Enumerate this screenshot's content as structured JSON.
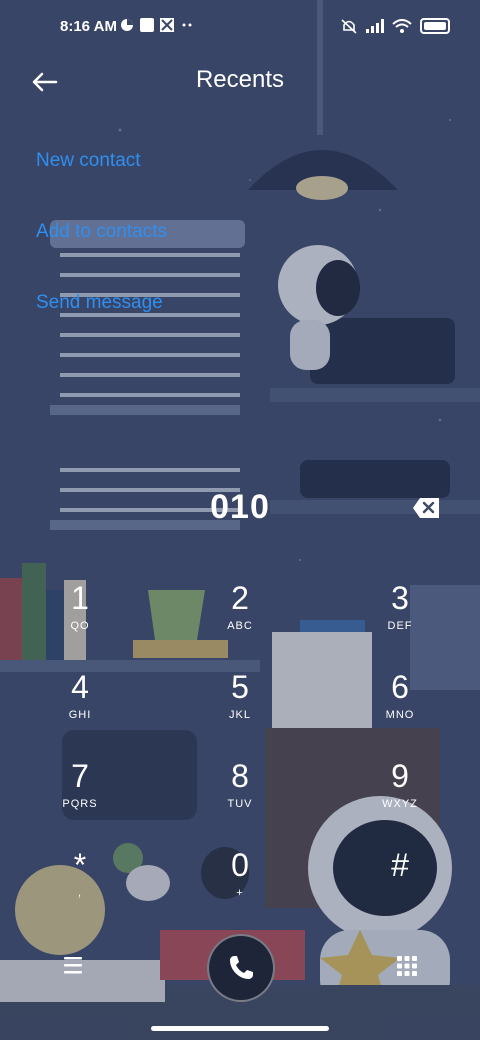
{
  "status_bar": {
    "time": "8:16 AM",
    "left_icons": [
      "data-saver-icon",
      "square-icon",
      "pinwheel-icon",
      "more-dots-icon"
    ],
    "right_icons": [
      "mute-icon",
      "signal-icon",
      "wifi-icon",
      "battery-icon"
    ]
  },
  "header": {
    "back_icon": "back-arrow-icon",
    "title": "Recents"
  },
  "options": {
    "new_contact": "New contact",
    "add_to_contacts": "Add to contacts",
    "send_message": "Send message"
  },
  "dialed": {
    "number": "010",
    "backspace_icon": "backspace-icon"
  },
  "keypad": {
    "keys": [
      {
        "digit": "1",
        "letters": "QO"
      },
      {
        "digit": "2",
        "letters": "ABC"
      },
      {
        "digit": "3",
        "letters": "DEF"
      },
      {
        "digit": "4",
        "letters": "GHI"
      },
      {
        "digit": "5",
        "letters": "JKL"
      },
      {
        "digit": "6",
        "letters": "MNO"
      },
      {
        "digit": "7",
        "letters": "PQRS"
      },
      {
        "digit": "8",
        "letters": "TUV"
      },
      {
        "digit": "9",
        "letters": "WXYZ"
      },
      {
        "digit": "*",
        "letters": ","
      },
      {
        "digit": "0",
        "letters": "+"
      },
      {
        "digit": "#",
        "letters": ""
      }
    ]
  },
  "bottom_bar": {
    "menu_icon": "menu-icon",
    "call_icon": "phone-icon",
    "dialpad_icon": "dialpad-icon"
  },
  "colors": {
    "background": "#3a4766",
    "link": "#2f8ff0"
  }
}
